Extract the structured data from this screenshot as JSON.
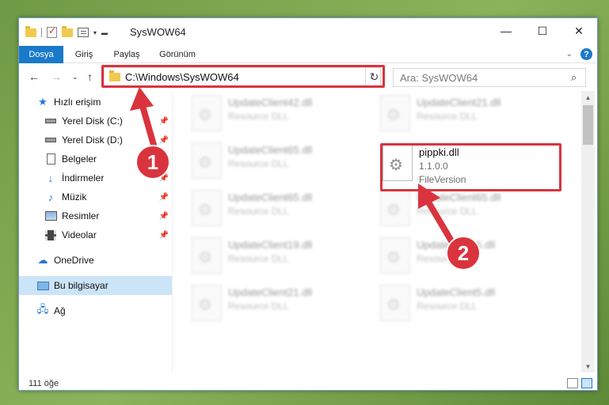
{
  "window": {
    "title": "SysWOW64",
    "controls": {
      "minimize": "—",
      "maximize": "☐",
      "close": "✕"
    }
  },
  "ribbon": {
    "tabs": [
      "Dosya",
      "Giriş",
      "Paylaş",
      "Görünüm"
    ],
    "active_color": "#1979ca"
  },
  "nav": {
    "address": "C:\\Windows\\SysWOW64",
    "search_placeholder": "Ara: SysWOW64"
  },
  "sidebar": {
    "items": [
      {
        "label": "Hızlı erişim",
        "icon": "star-icon"
      },
      {
        "label": "Yerel Disk (C:)",
        "icon": "disk-icon",
        "pinned": true
      },
      {
        "label": "Yerel Disk (D:)",
        "icon": "disk-icon",
        "pinned": true
      },
      {
        "label": "Belgeler",
        "icon": "document-icon",
        "pinned": true
      },
      {
        "label": "İndirmeler",
        "icon": "download-icon",
        "pinned": true
      },
      {
        "label": "Müzik",
        "icon": "music-icon",
        "pinned": true
      },
      {
        "label": "Resimler",
        "icon": "pictures-icon",
        "pinned": true
      },
      {
        "label": "Videolar",
        "icon": "videos-icon",
        "pinned": true
      },
      {
        "label": "OneDrive",
        "icon": "cloud-icon"
      },
      {
        "label": "Bu bilgisayar",
        "icon": "computer-icon",
        "selected": true
      },
      {
        "label": "Ağ",
        "icon": "network-icon"
      }
    ]
  },
  "files": [
    {
      "name": "UpdateClient42.dll",
      "sub": "Resource DLL",
      "blurred": true
    },
    {
      "name": "UpdateClient21.dll",
      "sub": "Resource DLL",
      "blurred": true
    },
    {
      "name": "UpdateClient65.dll",
      "sub": "Resource DLL",
      "blurred": true
    },
    {
      "name": "pippki.dll",
      "sub": "1.1.0.0",
      "sub2": "FileVersion",
      "blurred": false
    },
    {
      "name": "UpdateClient65.dll",
      "sub": "Resource DLL",
      "blurred": true
    },
    {
      "name": "UpdateClient65.dll",
      "sub": "Resource DLL",
      "blurred": true
    },
    {
      "name": "UpdateClient19.dll",
      "sub": "Resource DLL",
      "blurred": true
    },
    {
      "name": "UpdateClient5.dll",
      "sub": "Resource DLL",
      "blurred": true
    },
    {
      "name": "UpdateClient21.dll",
      "sub": "Resource DLL",
      "blurred": true
    },
    {
      "name": "UpdateClient5.dll",
      "sub": "Resource DLL",
      "blurred": true
    }
  ],
  "status": {
    "count": "111 öğe"
  },
  "annotations": {
    "step1": "1",
    "step2": "2",
    "highlight_color": "#d9343e"
  }
}
